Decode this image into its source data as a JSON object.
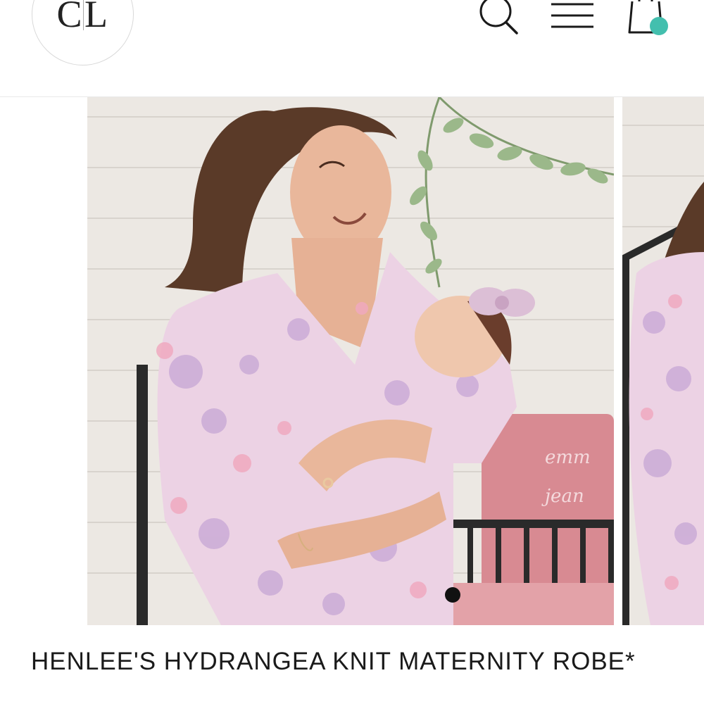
{
  "header": {
    "logo": {
      "left_letter": "C",
      "right_letter": "L"
    },
    "icons": {
      "search": "search-icon",
      "menu": "hamburger-menu-icon",
      "cart": "shopping-bag-icon"
    },
    "cart_badge_color": "#43bfae"
  },
  "gallery": {
    "slide_count_indicator": "dot",
    "caption_embroidery": "emm jean"
  },
  "product": {
    "title": "HENLEE'S HYDRANGEA KNIT MATERNITY ROBE*"
  }
}
